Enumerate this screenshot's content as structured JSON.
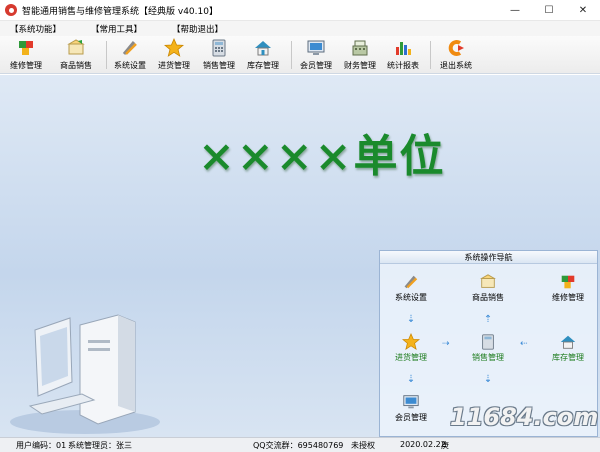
{
  "window": {
    "title": "智能通用销售与维修管理系统【经典版 v40.10】",
    "controls": {
      "minimize": "—",
      "maximize": "☐",
      "close": "✕"
    }
  },
  "menu": [
    "【系统功能】",
    "【常用工具】",
    "【帮助退出】"
  ],
  "toolbar": [
    {
      "label": "维修管理",
      "icon": "cubes-icon"
    },
    {
      "label": "商品销售",
      "icon": "goods-box-icon"
    },
    {
      "label": "系统设置",
      "icon": "wrench-pencil-icon"
    },
    {
      "label": "进货管理",
      "icon": "star-icon"
    },
    {
      "label": "销售管理",
      "icon": "calculator-icon"
    },
    {
      "label": "库存管理",
      "icon": "house-icon"
    },
    {
      "label": "会员管理",
      "icon": "monitor-icon"
    },
    {
      "label": "财务管理",
      "icon": "cash-register-icon"
    },
    {
      "label": "统计报表",
      "icon": "bar-chart-icon"
    },
    {
      "label": "退出系统",
      "icon": "exit-icon"
    }
  ],
  "company_name": "××××单位",
  "nav_panel": {
    "title": "系统操作导航",
    "nodes": {
      "settings": "系统设置",
      "goods": "商品销售",
      "repair": "维修管理",
      "purchase": "进货管理",
      "sales": "销售管理",
      "stock": "库存管理",
      "member": "会员管理"
    }
  },
  "status": {
    "user_code": "用户编码：01",
    "admin": "系统管理员：张三",
    "qq": "QQ交流群：695480769",
    "license": "未授权",
    "date": "2020.02.22",
    "extra": "庚"
  },
  "watermark": "11684.com",
  "colors": {
    "company": "#1a8a2c",
    "panel_border": "#9bb4d4"
  }
}
